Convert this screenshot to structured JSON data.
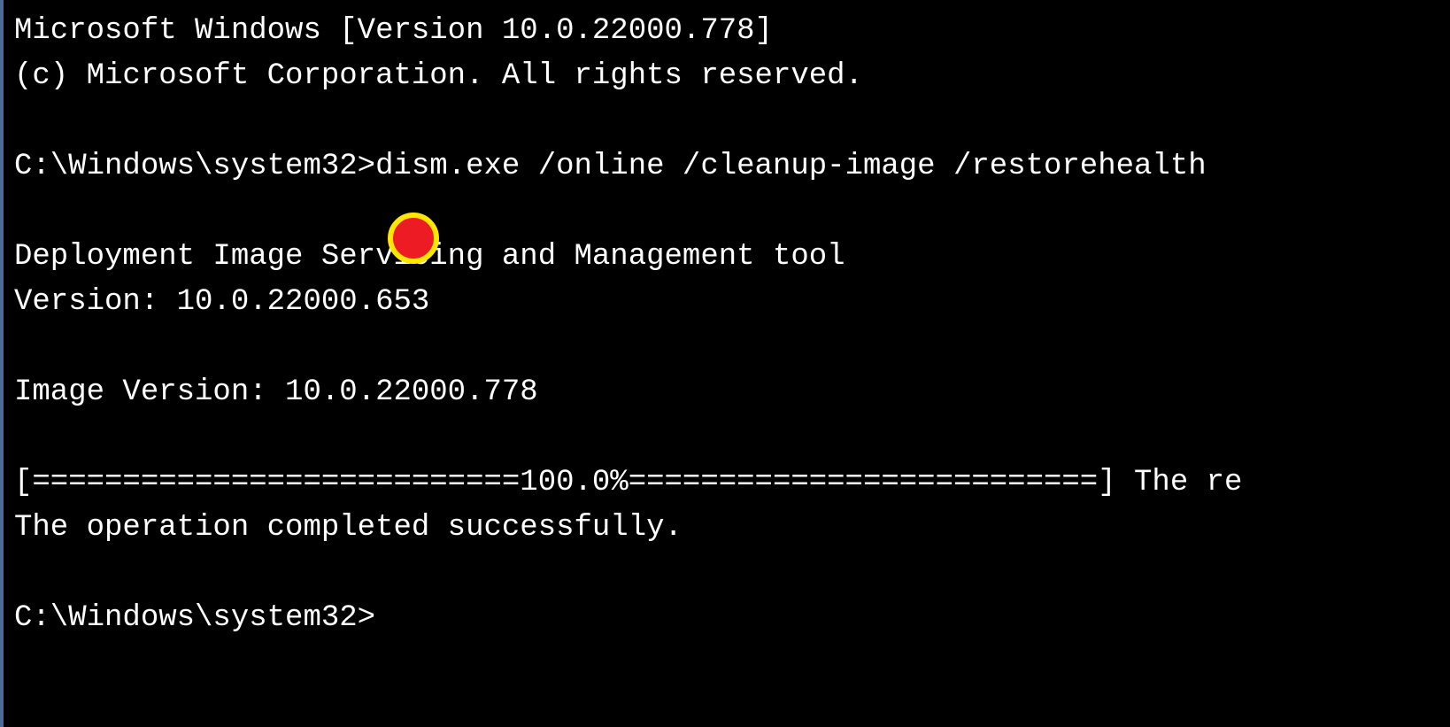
{
  "terminal": {
    "header_line1": "Microsoft Windows [Version 10.0.22000.778]",
    "header_line2": "(c) Microsoft Corporation. All rights reserved.",
    "prompt1": "C:\\Windows\\system32>",
    "command1": "dism.exe /online /cleanup-image /restorehealth",
    "output_line1": "Deployment Image Servicing and Management tool",
    "output_line2": "Version: 10.0.22000.653",
    "output_line3": "Image Version: 10.0.22000.778",
    "progress_line": "[===========================100.0%==========================] The re",
    "completion_line": "The operation completed successfully.",
    "prompt2": "C:\\Windows\\system32>"
  }
}
